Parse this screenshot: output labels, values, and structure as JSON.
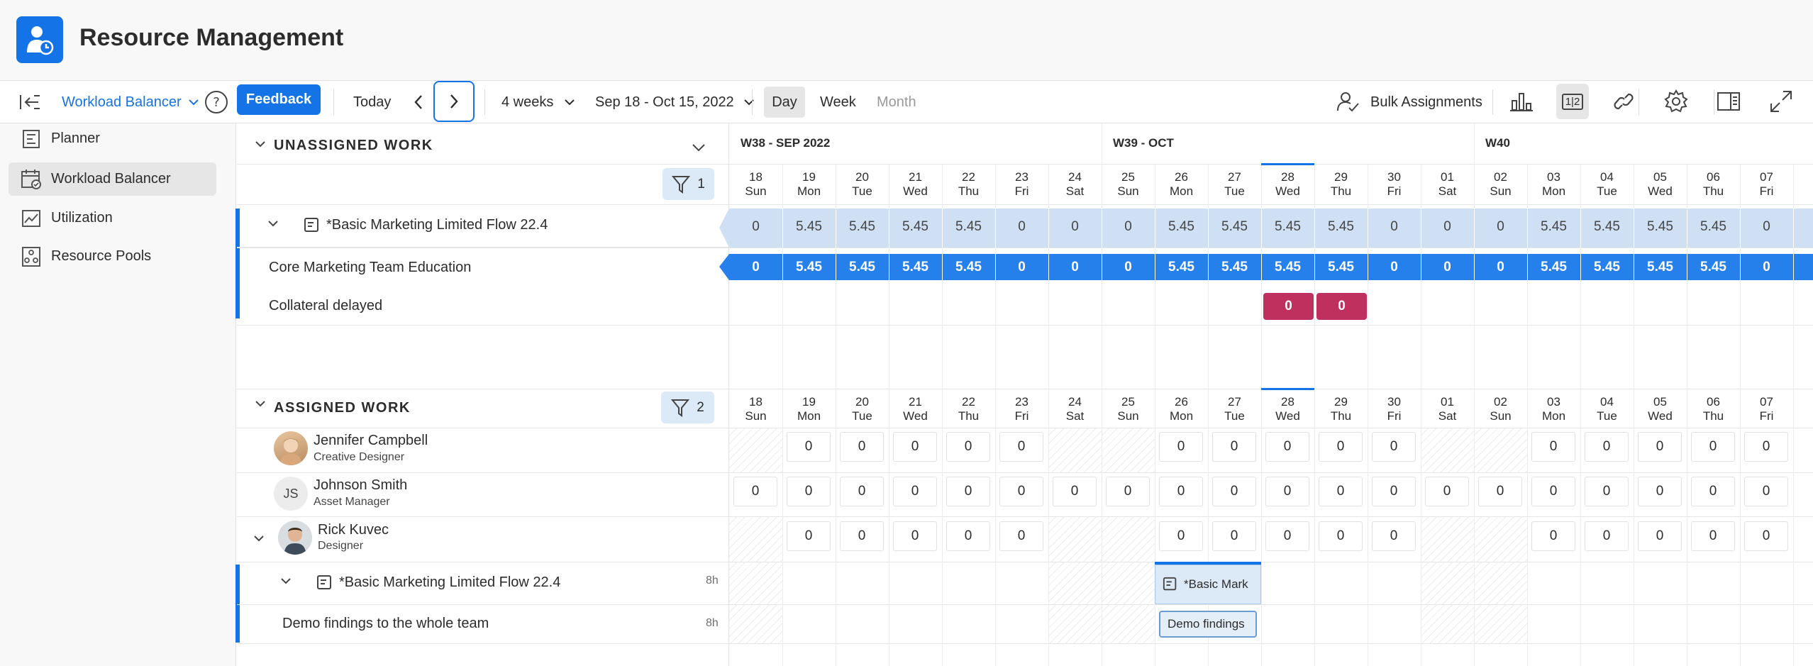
{
  "app": {
    "title": "Resource Management"
  },
  "toolbar": {
    "view_label": "Workload Balancer",
    "feedback_label": "Feedback",
    "today_label": "Today",
    "range_label": "4 weeks",
    "date_range": "Sep 18 - Oct 15, 2022",
    "day_label": "Day",
    "week_label": "Week",
    "month_label": "Month",
    "bulk_label": "Bulk Assignments",
    "compact_label": "1|2"
  },
  "sidebar": {
    "items": [
      {
        "label": "Planner",
        "icon": "planner-icon",
        "active": false
      },
      {
        "label": "Workload Balancer",
        "icon": "workload-balancer-icon",
        "active": true
      },
      {
        "label": "Utilization",
        "icon": "utilization-icon",
        "active": false
      },
      {
        "label": "Resource Pools",
        "icon": "resource-pools-icon",
        "active": false
      }
    ]
  },
  "calendar": {
    "weeks": [
      "W38 - SEP 2022",
      "W39 - OCT",
      "W40"
    ],
    "days": [
      {
        "d": "18",
        "w": "Sun"
      },
      {
        "d": "19",
        "w": "Mon"
      },
      {
        "d": "20",
        "w": "Tue"
      },
      {
        "d": "21",
        "w": "Wed"
      },
      {
        "d": "22",
        "w": "Thu"
      },
      {
        "d": "23",
        "w": "Fri"
      },
      {
        "d": "24",
        "w": "Sat"
      },
      {
        "d": "25",
        "w": "Sun"
      },
      {
        "d": "26",
        "w": "Mon"
      },
      {
        "d": "27",
        "w": "Tue"
      },
      {
        "d": "28",
        "w": "Wed"
      },
      {
        "d": "29",
        "w": "Thu"
      },
      {
        "d": "30",
        "w": "Fri"
      },
      {
        "d": "01",
        "w": "Sat"
      },
      {
        "d": "02",
        "w": "Sun"
      },
      {
        "d": "03",
        "w": "Mon"
      },
      {
        "d": "04",
        "w": "Tue"
      },
      {
        "d": "05",
        "w": "Wed"
      },
      {
        "d": "06",
        "w": "Thu"
      },
      {
        "d": "07",
        "w": "Fri"
      }
    ],
    "today_index": 10
  },
  "unassigned": {
    "title": "UNASSIGNED WORK",
    "filter_count": "1",
    "project": {
      "name": "*Basic Marketing Limited Flow 22.4",
      "values": [
        "0",
        "5.45",
        "5.45",
        "5.45",
        "5.45",
        "0",
        "0",
        "0",
        "5.45",
        "5.45",
        "5.45",
        "5.45",
        "0",
        "0",
        "0",
        "5.45",
        "5.45",
        "5.45",
        "5.45",
        "0"
      ]
    },
    "tasks": [
      {
        "name": "Core Marketing Team Education",
        "values": [
          "0",
          "5.45",
          "5.45",
          "5.45",
          "5.45",
          "0",
          "0",
          "0",
          "5.45",
          "5.45",
          "5.45",
          "5.45",
          "0",
          "0",
          "0",
          "5.45",
          "5.45",
          "5.45",
          "5.45",
          "0"
        ]
      },
      {
        "name": "Collateral delayed",
        "values": [
          "0",
          "0"
        ]
      }
    ]
  },
  "assigned": {
    "title": "ASSIGNED WORK",
    "filter_count": "2",
    "people": [
      {
        "name": "Jennifer Campbell",
        "role": "Creative Designer",
        "initials": "",
        "values": [
          "",
          "0",
          "0",
          "0",
          "0",
          "0",
          "",
          "",
          "0",
          "0",
          "0",
          "0",
          "0",
          "",
          "",
          "0",
          "0",
          "0",
          "0",
          "0"
        ]
      },
      {
        "name": "Johnson Smith",
        "role": "Asset Manager",
        "initials": "JS",
        "values": [
          "0",
          "0",
          "0",
          "0",
          "0",
          "0",
          "0",
          "0",
          "0",
          "0",
          "0",
          "0",
          "0",
          "0",
          "0",
          "0",
          "0",
          "0",
          "0",
          "0"
        ]
      },
      {
        "name": "Rick Kuvec",
        "role": "Designer",
        "initials": "",
        "values": [
          "",
          "0",
          "0",
          "0",
          "0",
          "0",
          "",
          "",
          "0",
          "0",
          "0",
          "0",
          "0",
          "",
          "",
          "0",
          "0",
          "0",
          "0",
          "0"
        ]
      }
    ],
    "project": {
      "name": "*Basic Marketing Limited Flow 22.4",
      "hours": "8h",
      "chip": "*Basic Mark"
    },
    "task": {
      "name": "Demo findings to the whole team",
      "hours": "8h",
      "chip": "Demo findings"
    }
  },
  "colors": {
    "accent": "#1473e6",
    "bar_light": "#cfe0f5",
    "bar_dark": "#2680eb",
    "overdue": "#c0305e"
  }
}
